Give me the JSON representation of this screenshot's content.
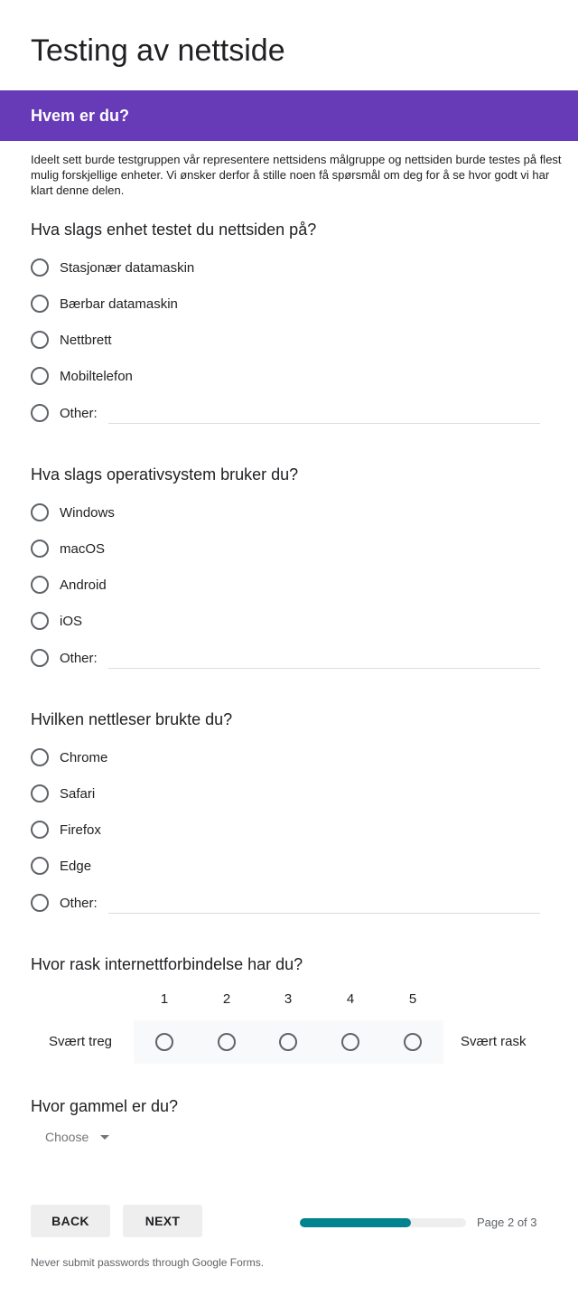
{
  "form": {
    "title": "Testing av nettside"
  },
  "section": {
    "title": "Hvem er du?",
    "description": "Ideelt sett burde testgruppen vår representere nettsidens målgruppe og nettsiden burde testes på flest mulig forskjellige enheter. Vi ønsker derfor å stille noen få spørsmål om deg for å se hvor godt vi har klart denne delen."
  },
  "questions": {
    "device": {
      "title": "Hva slags enhet testet du nettsiden på?",
      "options": [
        "Stasjonær datamaskin",
        "Bærbar datamaskin",
        "Nettbrett",
        "Mobiltelefon"
      ],
      "other_label": "Other:"
    },
    "os": {
      "title": "Hva slags operativsystem bruker du?",
      "options": [
        "Windows",
        "macOS",
        "Android",
        "iOS"
      ],
      "other_label": "Other:"
    },
    "browser": {
      "title": "Hvilken nettleser brukte du?",
      "options": [
        "Chrome",
        "Safari",
        "Firefox",
        "Edge"
      ],
      "other_label": "Other:"
    },
    "speed": {
      "title": "Hvor rask internettforbindelse har du?",
      "scale": [
        "1",
        "2",
        "3",
        "4",
        "5"
      ],
      "low_label": "Svært treg",
      "high_label": "Svært rask"
    },
    "age": {
      "title": "Hvor gammel er du?",
      "dropdown_value": "Choose"
    }
  },
  "navigation": {
    "back_label": "BACK",
    "next_label": "NEXT",
    "page_indicator": "Page 2 of 3",
    "progress_fraction": 0.67
  },
  "footer": {
    "text": "Never submit passwords through Google Forms."
  },
  "colors": {
    "accent": "#673ab7",
    "progress": "#00838f"
  }
}
